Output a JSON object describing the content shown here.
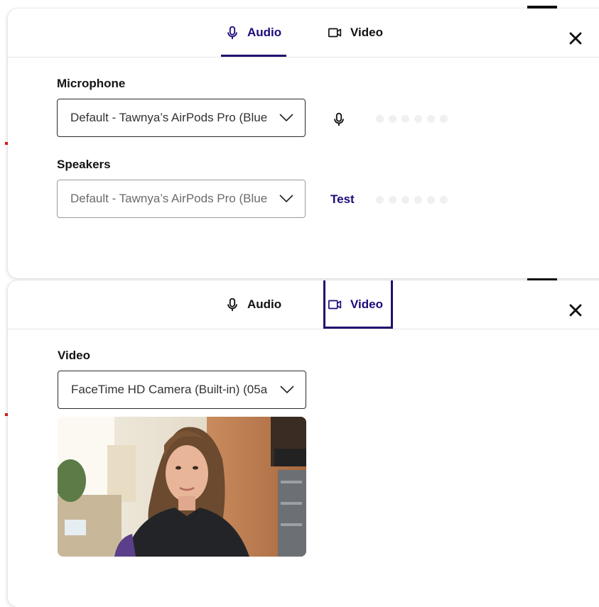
{
  "tabs": {
    "audio_label": "Audio",
    "video_label": "Video"
  },
  "audio_panel": {
    "active_tab": "Audio",
    "microphone": {
      "label": "Microphone",
      "selected": "Default - Tawnya’s AirPods Pro (Blue",
      "meter_level": 0,
      "meter_dots": 6
    },
    "speakers": {
      "label": "Speakers",
      "selected": "Default - Tawnya’s AirPods Pro (Blue",
      "test_label": "Test",
      "meter_level": 0,
      "meter_dots": 6
    }
  },
  "video_panel": {
    "active_tab": "Video",
    "camera": {
      "label": "Video",
      "selected": "FaceTime HD Camera (Built-in) (05a"
    }
  },
  "icons": {
    "audio_tab": "microphone-icon",
    "video_tab": "video-camera-icon",
    "close": "close-icon",
    "dropdown": "chevron-down-icon",
    "mic_status": "microphone-icon"
  },
  "colors": {
    "accent": "#1e0a7a",
    "underline": "#22106e",
    "text": "#141414",
    "muted_text": "#6b6b6b",
    "meter_dot": "#f0f0f0"
  }
}
